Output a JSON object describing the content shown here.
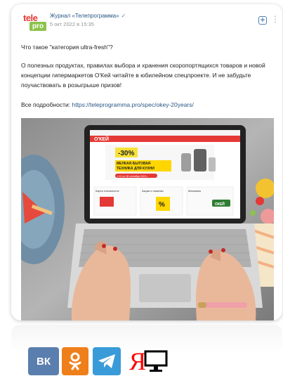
{
  "post": {
    "author": "Журнал «Телепрограмма»",
    "date": "5 окт 2022 в 15:35",
    "logo_line1": "tele",
    "logo_line2": "pro",
    "paragraph1": "Что такое \"категория ultra-fresh\"?",
    "paragraph2": "О полезных продуктах, правилах выбора и хранения скоропортящихся товаров и новой концепции гипермаркетов О'Кей читайте в юбилейном спецпроекте. И не забудьте поучаствовать в розыгрыше призов!",
    "more_label": "Все подробности:",
    "more_link": "https://teleprogramma.pro/spec/okey-20years/"
  },
  "screen": {
    "brand": "О'КЕЙ",
    "discount": "-30%",
    "promo_line1": "МЕЛКАЯ БЫТОВАЯ",
    "promo_line2": "ТЕХНИКА ДЛЯ КУХНИ",
    "promo_dates": "с 11 по 18 сентября 2022 г.",
    "tile_labels": [
      "Карта лояльности",
      "Акции и новинки",
      "Магазины"
    ],
    "badge": "%",
    "tile_btn": "ОКЕЙ"
  },
  "share": {
    "vk": "ВК",
    "ok": "ОК",
    "ya": "Я"
  },
  "colors": {
    "vk": "#5a7fae",
    "ok": "#ef7f1a",
    "telegram": "#3a9bd9",
    "yandex": "#ff0000",
    "link": "#2a5885"
  }
}
